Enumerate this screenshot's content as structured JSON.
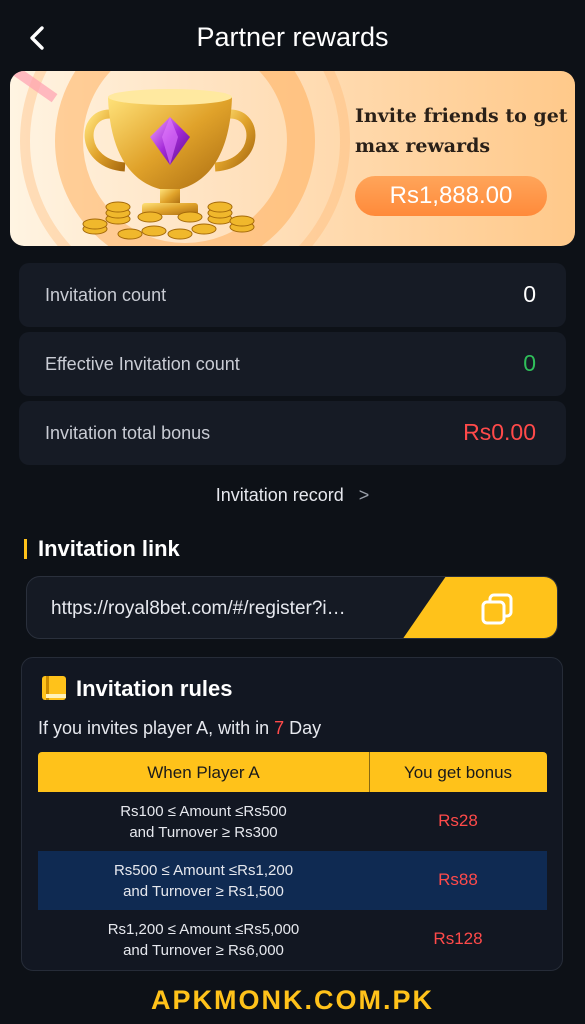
{
  "header": {
    "title": "Partner rewards"
  },
  "banner": {
    "headline_line1": "Invite friends to get",
    "headline_line2": "max rewards",
    "reward_amount": "Rs1,888.00"
  },
  "stats": [
    {
      "label": "Invitation count",
      "value": "0",
      "color": "#ffffff"
    },
    {
      "label": "Effective Invitation count",
      "value": "0",
      "color": "#2fbf5a"
    },
    {
      "label": "Invitation total bonus",
      "value": "Rs0.00",
      "color": "#ff4a4a"
    }
  ],
  "record_link": {
    "label": "Invitation record",
    "chevron": ">"
  },
  "invitation_link": {
    "heading": "Invitation link",
    "url": "https://royal8bet.com/#/register?i…"
  },
  "rules": {
    "heading": "Invitation rules",
    "desc_prefix": "If you invites player A, with in",
    "desc_days": "7",
    "desc_suffix": "Day",
    "col1": "When Player A",
    "col2": "You get bonus",
    "rows": [
      {
        "line1": "Rs100 ≤ Amount ≤Rs500",
        "line2": "and Turnover ≥ Rs300",
        "bonus": "Rs28"
      },
      {
        "line1": "Rs500 ≤ Amount ≤Rs1,200",
        "line2": "and Turnover ≥ Rs1,500",
        "bonus": "Rs88"
      },
      {
        "line1": "Rs1,200 ≤ Amount ≤Rs5,000",
        "line2": "and Turnover ≥ Rs6,000",
        "bonus": "Rs128"
      }
    ]
  },
  "watermark": "APKMONK.COM.PK",
  "colors": {
    "accent": "#ffc21a",
    "background": "#0d1117",
    "card": "#161b25",
    "danger": "#ff4a4a",
    "success": "#2fbf5a"
  },
  "icons": [
    "back-arrow-icon",
    "trophy-illustration",
    "chevron-right-icon",
    "copy-icon",
    "book-icon"
  ]
}
